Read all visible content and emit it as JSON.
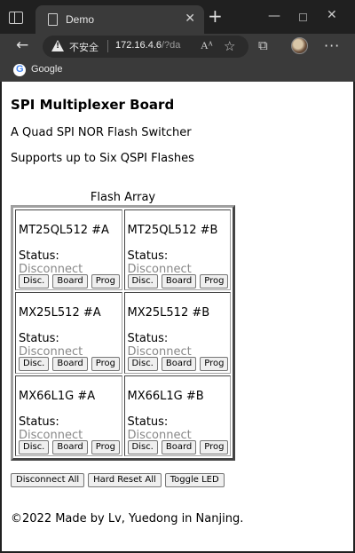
{
  "browser": {
    "tab_title": "Demo",
    "tab_close": "✕",
    "new_tab": "+",
    "minimize": "—",
    "close": "✕",
    "back": "←",
    "security_label": "不安全",
    "url_host": "172.16.4.6",
    "url_rest": "/?da",
    "read_aloud": "Aᴬ",
    "favorites_icon": "☆",
    "extensions_icon": "⧉",
    "more": "···",
    "bookmark_label": "Google"
  },
  "page": {
    "title": "SPI Multiplexer Board",
    "subtitle": "A Quad SPI NOR Flash Switcher",
    "support": "Supports up to Six QSPI Flashes",
    "table_caption": "Flash Array",
    "status_label": "Status:",
    "cells": [
      {
        "chip": "MT25QL512 #A",
        "status": "Disconnect",
        "disc": "Disc.",
        "board": "Board",
        "prog": "Prog"
      },
      {
        "chip": "MT25QL512 #B",
        "status": "Disconnect",
        "disc": "Disc.",
        "board": "Board",
        "prog": "Prog"
      },
      {
        "chip": "MX25L512 #A",
        "status": "Disconnect",
        "disc": "Disc.",
        "board": "Board",
        "prog": "Prog"
      },
      {
        "chip": "MX25L512 #B",
        "status": "Disconnect",
        "disc": "Disc.",
        "board": "Board",
        "prog": "Prog"
      },
      {
        "chip": "MX66L1G #A",
        "status": "Disconnect",
        "disc": "Disc.",
        "board": "Board",
        "prog": "Prog"
      },
      {
        "chip": "MX66L1G #B",
        "status": "Disconnect",
        "disc": "Disc.",
        "board": "Board",
        "prog": "Prog"
      }
    ],
    "disconnect_all": "Disconnect All",
    "hard_reset_all": "Hard Reset All",
    "toggle_led": "Toggle LED",
    "footer": "©2022 Made by Lv, Yuedong in Nanjing."
  }
}
